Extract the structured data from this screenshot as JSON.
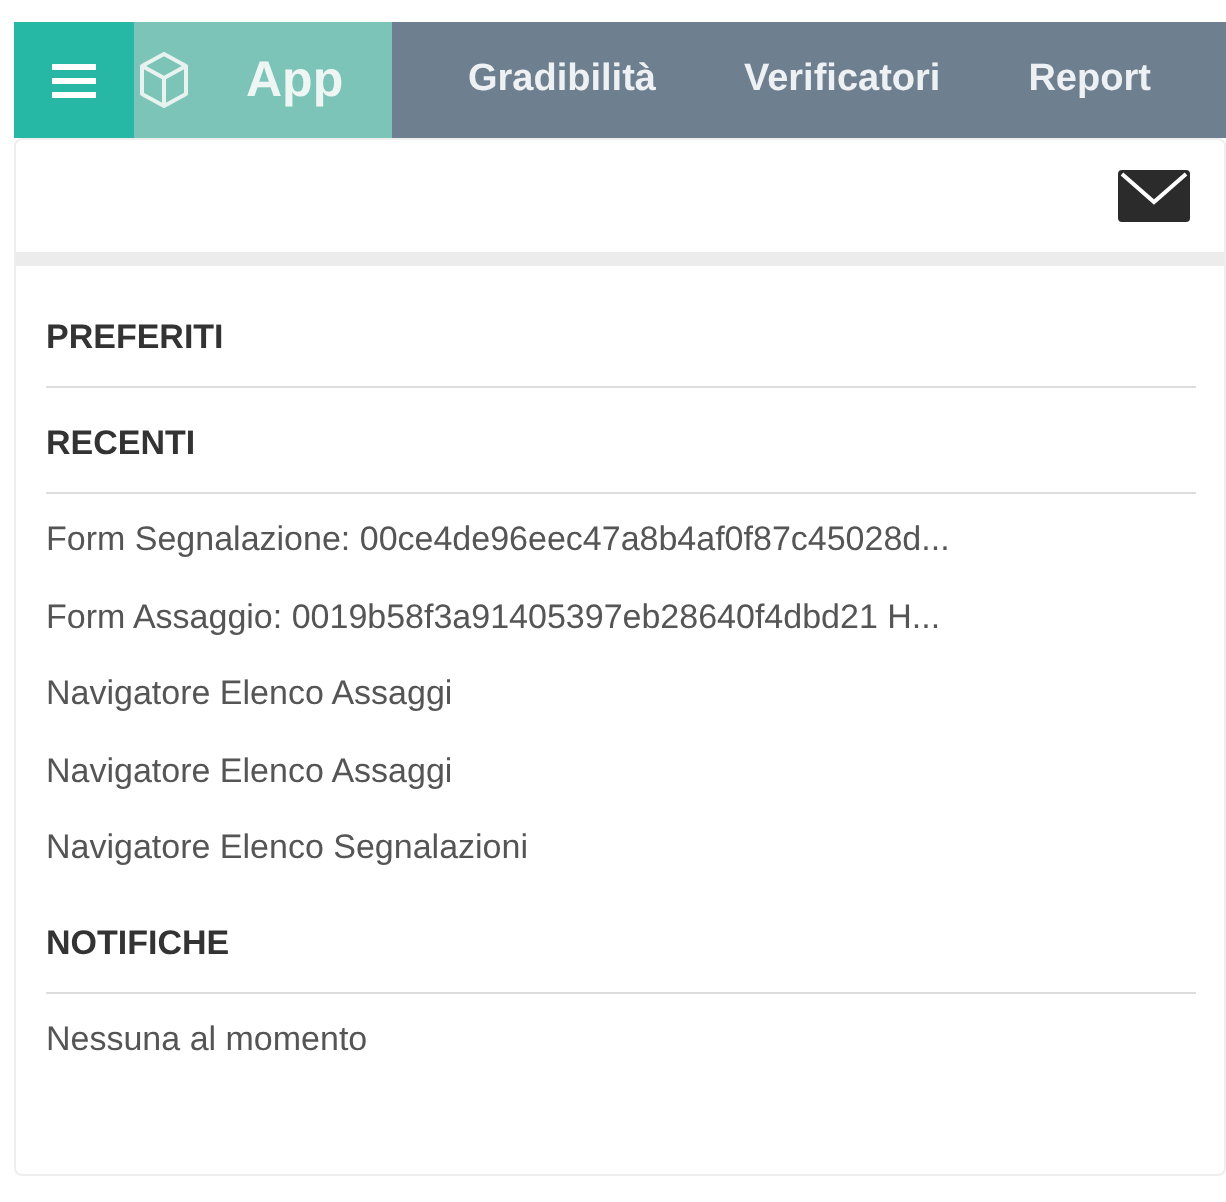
{
  "topbar": {
    "app_title": "App",
    "nav": [
      "Gradibilità",
      "Verificatori",
      "Report"
    ]
  },
  "sections": [
    {
      "title": "PREFERITI"
    },
    {
      "title": "RECENTI",
      "items": [
        "Form Segnalazione: 00ce4de96eec47a8b4af0f87c45028d...",
        "Form Assaggio: 0019b58f3a91405397eb28640f4dbd21 H...",
        "Navigatore Elenco Assaggi",
        "Navigatore Elenco Assaggi",
        "Navigatore Elenco Segnalazioni"
      ]
    },
    {
      "title": "NOTIFICHE",
      "items": [
        "Nessuna al momento"
      ]
    }
  ]
}
